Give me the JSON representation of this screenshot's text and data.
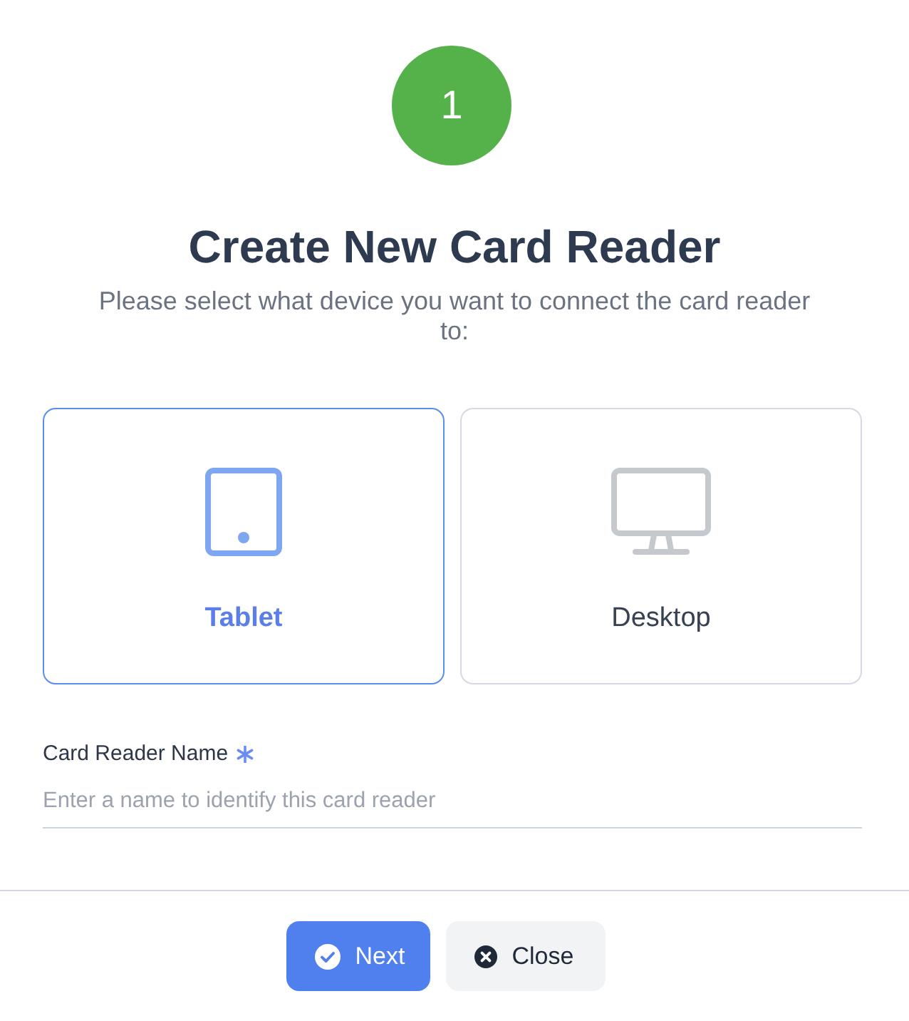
{
  "step": {
    "number": "1"
  },
  "title": "Create New Card Reader",
  "subtitle": "Please select what device you want to connect the card reader to:",
  "device_options": [
    {
      "kind": "tablet",
      "label": "Tablet",
      "selected": true
    },
    {
      "kind": "desktop",
      "label": "Desktop",
      "selected": false
    }
  ],
  "name_field": {
    "label": "Card Reader Name",
    "required": true,
    "placeholder": "Enter a name to identify this card reader"
  },
  "buttons": [
    {
      "kind": "primary",
      "label": "Next"
    },
    {
      "kind": "secondary",
      "label": "Close"
    }
  ]
}
